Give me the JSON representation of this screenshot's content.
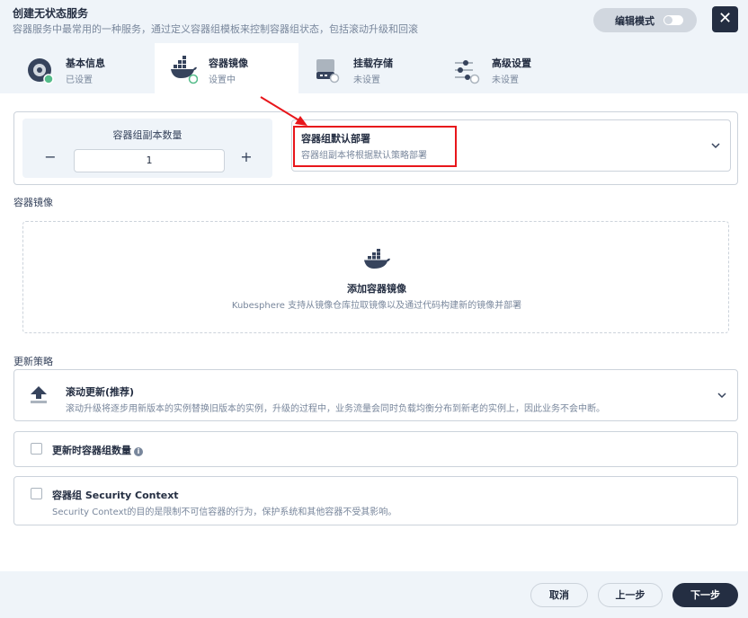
{
  "header": {
    "title": "创建无状态服务",
    "subtitle": "容器服务中最常用的一种服务，通过定义容器组模板来控制容器组状态，包括滚动升级和回滚",
    "edit_mode_label": "编辑模式",
    "close_label": "✕"
  },
  "tabs": [
    {
      "label": "基本信息",
      "status": "已设置",
      "icon": "disk-icon"
    },
    {
      "label": "容器镜像",
      "status": "设置中",
      "icon": "docker-icon"
    },
    {
      "label": "挂载存储",
      "status": "未设置",
      "icon": "storage-icon"
    },
    {
      "label": "高级设置",
      "status": "未设置",
      "icon": "sliders-icon"
    }
  ],
  "replicas": {
    "label": "容器组副本数量",
    "value": "1",
    "minus": "−",
    "plus": "+"
  },
  "deploy_policy": {
    "title": "容器组默认部署",
    "desc": "容器组副本将根据默认策略部署"
  },
  "container_image": {
    "section_label": "容器镜像",
    "add_title": "添加容器镜像",
    "add_desc": "Kubesphere 支持从镜像仓库拉取镜像以及通过代码构建新的镜像并部署"
  },
  "update_strategy": {
    "section_label": "更新策略",
    "title": "滚动更新(推荐)",
    "desc": "滚动升级将逐步用新版本的实例替换旧版本的实例，升级的过程中，业务流量会同时负载均衡分布到新老的实例上，因此业务不会中断。"
  },
  "update_replicas": {
    "label": "更新时容器组数量",
    "info": "i"
  },
  "security_context": {
    "title": "容器组 Security Context",
    "desc": "Security Context的目的是限制不可信容器的行为，保护系统和其他容器不受其影响。"
  },
  "footer": {
    "cancel": "取消",
    "prev": "上一步",
    "next": "下一步"
  },
  "colors": {
    "primary_dark": "#242e42",
    "background": "#eff4f9",
    "border": "#ccd3db",
    "annotation_red": "#e8161b",
    "success_green": "#55bc8a"
  }
}
